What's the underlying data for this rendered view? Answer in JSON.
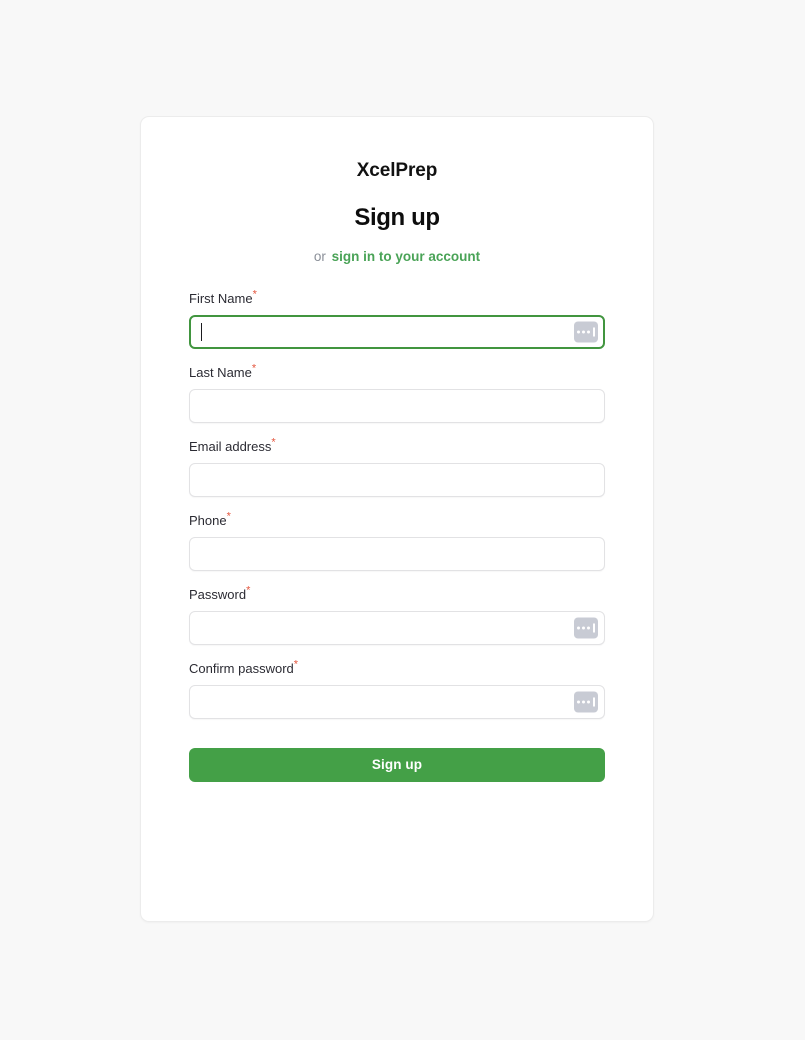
{
  "page": {
    "background_color": "#f8f8f8"
  },
  "card": {
    "brand": "XcelPrep",
    "heading": "Sign up",
    "subline": {
      "or_text": "or",
      "link_label": "sign in to your account",
      "link_color": "#4aa357"
    },
    "required_marker": "*",
    "fields": [
      {
        "label": "First Name",
        "required": true,
        "value": "",
        "placeholder": "",
        "type": "text",
        "focused": true,
        "has_password_manager_badge": true
      },
      {
        "label": "Last Name",
        "required": true,
        "value": "",
        "placeholder": "",
        "type": "text",
        "focused": false,
        "has_password_manager_badge": false
      },
      {
        "label": "Email address",
        "required": true,
        "value": "",
        "placeholder": "",
        "type": "email",
        "focused": false,
        "has_password_manager_badge": false
      },
      {
        "label": "Phone",
        "required": true,
        "value": "",
        "placeholder": "",
        "type": "tel",
        "focused": false,
        "has_password_manager_badge": false
      },
      {
        "label": "Password",
        "required": true,
        "value": "",
        "placeholder": "",
        "type": "password",
        "focused": false,
        "has_password_manager_badge": true
      },
      {
        "label": "Confirm password",
        "required": true,
        "value": "",
        "placeholder": "",
        "type": "password",
        "focused": false,
        "has_password_manager_badge": true
      }
    ],
    "submit": {
      "label": "Sign up",
      "color": "#44a047"
    }
  },
  "icons": {
    "password_manager_badge": "password-manager-icon"
  }
}
